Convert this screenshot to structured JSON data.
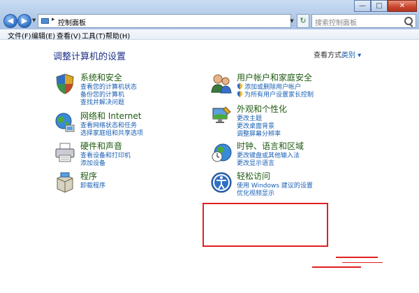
{
  "address": {
    "path": "控制面板"
  },
  "search": {
    "placeholder": "搜索控制面板"
  },
  "window_controls": {
    "minimize": "—",
    "maximize": "□",
    "close": "✕"
  },
  "menu": [
    {
      "label": "文件(F)"
    },
    {
      "label": "编辑(E)"
    },
    {
      "label": "查看(V)"
    },
    {
      "label": "工具(T)"
    },
    {
      "label": "帮助(H)"
    }
  ],
  "content": {
    "title": "调整计算机的设置",
    "view_by_label": "查看方式:",
    "view_by_value": "类别 ▾"
  },
  "categories": {
    "system_security": {
      "title": "系统和安全",
      "links": [
        "查看您的计算机状态",
        "备份您的计算机",
        "查找并解决问题"
      ]
    },
    "network": {
      "title": "网络和 Internet",
      "links": [
        "查看网络状态和任务",
        "选择家庭组和共享选项"
      ]
    },
    "hardware": {
      "title": "硬件和声音",
      "links": [
        "查看设备和打印机",
        "添加设备"
      ]
    },
    "programs": {
      "title": "程序",
      "links": [
        "卸载程序"
      ]
    },
    "user_accounts": {
      "title": "用户帐户和家庭安全",
      "links": [
        "添加或删除用户帐户",
        "为所有用户设置家长控制"
      ]
    },
    "appearance": {
      "title": "外观和个性化",
      "links": [
        "更改主题",
        "更改桌面背景",
        "调整屏幕分辨率"
      ]
    },
    "clock": {
      "title": "时钟、语言和区域",
      "links": [
        "更改键盘或其他输入法",
        "更改显示语言"
      ]
    },
    "ease_access": {
      "title": "轻松访问",
      "links": [
        "使用 Windows 建议的设置",
        "优化视频显示"
      ]
    }
  },
  "colors": {
    "link": "#1a5fb4",
    "category_title": "#1e5a10",
    "page_title": "#1e3287",
    "annotation": "#e02020"
  }
}
